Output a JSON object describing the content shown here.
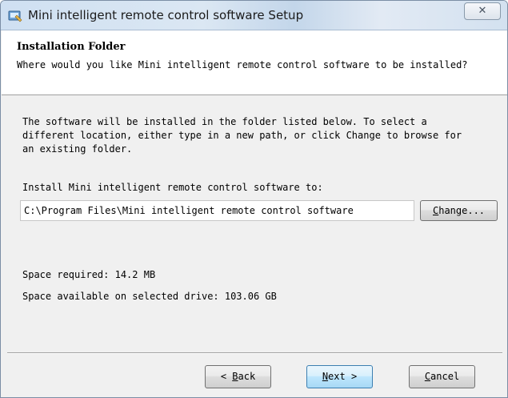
{
  "window": {
    "title": "Mini intelligent remote control software Setup",
    "close_glyph": "✕",
    "app_icon": "installer-icon"
  },
  "header": {
    "title": "Installation Folder",
    "subtitle": "Where would you like Mini intelligent remote control software to be installed?"
  },
  "body": {
    "description": "The software will be installed in the folder listed below. To select a\ndifferent location, either type in a new path, or click Change to browse for\nan existing folder.",
    "install_label": "Install Mini intelligent remote control software to:",
    "install_path": "C:\\Program Files\\Mini intelligent remote control software",
    "change_button": {
      "mnemonic": "C",
      "rest": "hange..."
    },
    "space_required": "Space required: 14.2 MB",
    "space_available": "Space available on selected drive: 103.06 GB"
  },
  "buttons": {
    "back": {
      "prefix": "< ",
      "mnemonic": "B",
      "rest": "ack"
    },
    "next": {
      "mnemonic": "N",
      "rest": "ext >"
    },
    "cancel": {
      "mnemonic": "C",
      "rest": "ancel"
    }
  },
  "colors": {
    "next_border": "#3c7fb1",
    "titlebar": "#cfe0f2"
  }
}
